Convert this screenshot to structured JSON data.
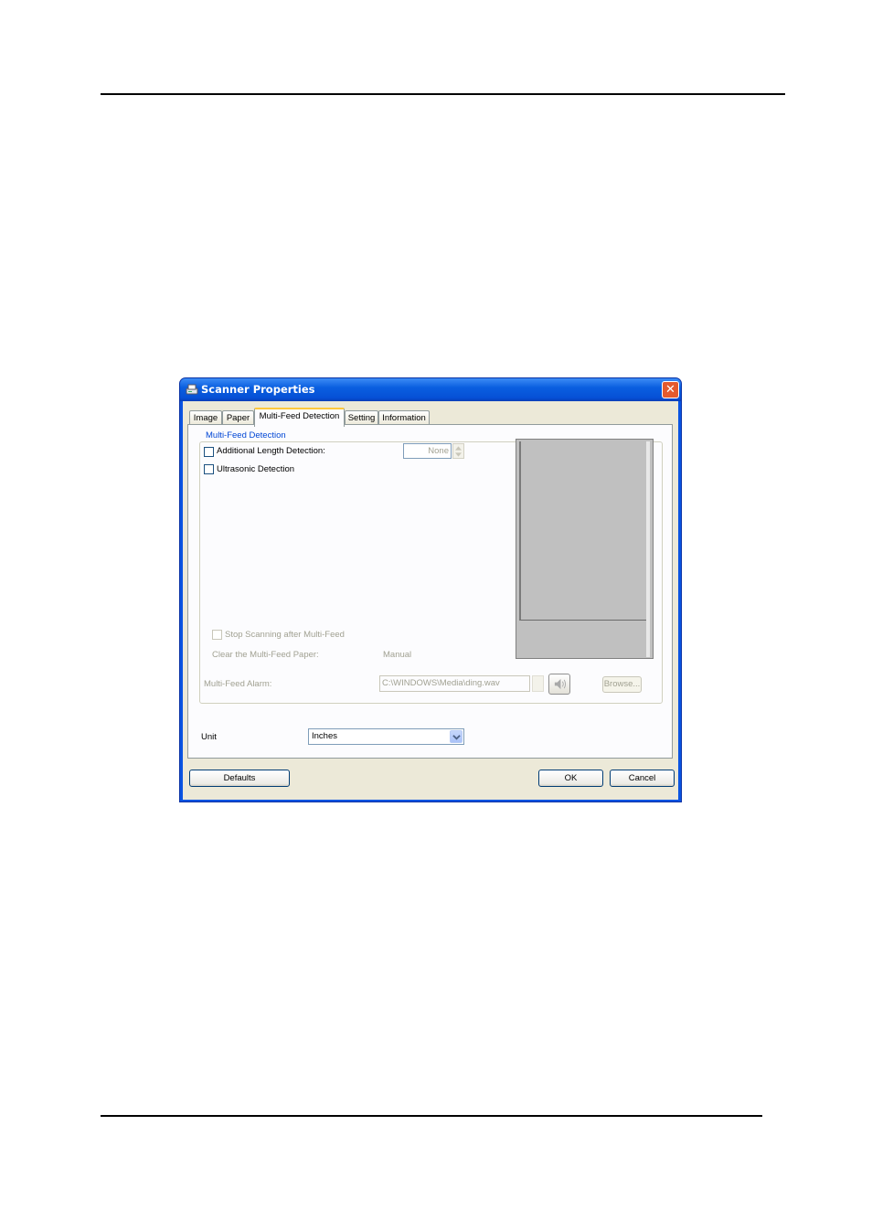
{
  "dialog": {
    "title": "Scanner Properties",
    "close_glyph": "✕",
    "tabs": [
      {
        "label": "Image",
        "active": false
      },
      {
        "label": "Paper",
        "active": false
      },
      {
        "label": "Multi-Feed Detection",
        "active": true
      },
      {
        "label": "Setting",
        "active": false
      },
      {
        "label": "Information",
        "active": false
      }
    ],
    "group": {
      "title": "Multi-Feed Detection",
      "additional_length_label": "Additional Length Detection:",
      "additional_length_checked": false,
      "additional_length_value": "None",
      "ultrasonic_label": "Ultrasonic Detection",
      "ultrasonic_checked": false,
      "stop_scanning_label": "Stop Scanning after Multi-Feed",
      "clear_paper_label": "Clear the Multi-Feed Paper:",
      "clear_paper_value": "Manual",
      "alarm_label": "Multi-Feed Alarm:",
      "alarm_path": "C:\\WINDOWS\\Media\\ding.wav",
      "browse_label": "Browse..."
    },
    "unit": {
      "label": "Unit",
      "selected": "Inches"
    },
    "buttons": {
      "defaults": "Defaults",
      "ok": "OK",
      "cancel": "Cancel"
    },
    "colors": {
      "title_bar": "#0a54e2",
      "face": "#ece9d8",
      "preview": "#c0c0c0"
    },
    "icons": [
      "scanner-icon",
      "close-icon",
      "spin-up-icon",
      "spin-down-icon",
      "speaker-icon",
      "dropdown-arrow-icon"
    ]
  }
}
